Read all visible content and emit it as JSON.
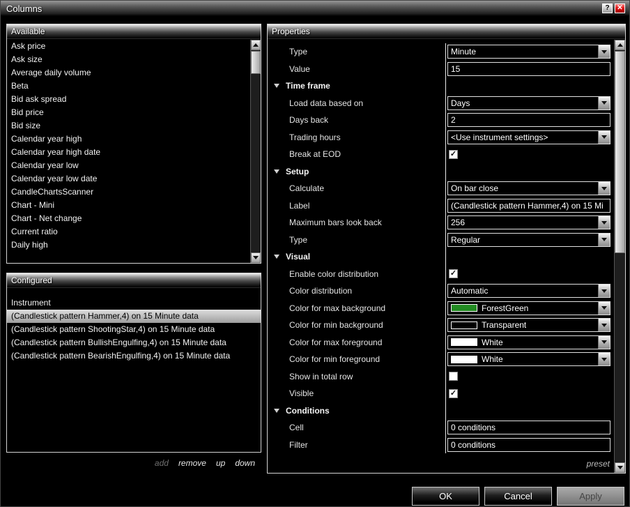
{
  "window": {
    "title": "Columns",
    "help_label": "?",
    "close_label": "✕"
  },
  "available_panel": {
    "header": "Available",
    "items": [
      "Ask price",
      "Ask size",
      "Average daily volume",
      "Beta",
      "Bid ask spread",
      "Bid price",
      "Bid size",
      "Calendar year high",
      "Calendar year high date",
      "Calendar year low",
      "Calendar year low date",
      "CandleChartsScanner",
      "Chart - Mini",
      "Chart - Net change",
      "Current ratio",
      "Daily high"
    ]
  },
  "configured_panel": {
    "header": "Configured",
    "items": [
      {
        "label": "Instrument",
        "selected": false
      },
      {
        "label": "(Candlestick pattern Hammer,4) on 15 Minute data",
        "selected": true
      },
      {
        "label": "(Candlestick pattern ShootingStar,4) on 15 Minute data",
        "selected": false
      },
      {
        "label": "(Candlestick pattern BullishEngulfing,4) on 15 Minute data",
        "selected": false
      },
      {
        "label": "(Candlestick pattern BearishEngulfing,4) on 15 Minute data",
        "selected": false
      }
    ],
    "actions": [
      {
        "label": "add",
        "enabled": false
      },
      {
        "label": "remove",
        "enabled": true
      },
      {
        "label": "up",
        "enabled": true
      },
      {
        "label": "down",
        "enabled": true
      }
    ]
  },
  "properties_panel": {
    "header": "Properties",
    "preset_label": "preset",
    "rows": [
      {
        "kind": "dropdown",
        "label": "Type",
        "value": "Minute"
      },
      {
        "kind": "input",
        "label": "Value",
        "value": "15"
      },
      {
        "kind": "section",
        "label": "Time frame"
      },
      {
        "kind": "dropdown",
        "label": "Load data based on",
        "value": "Days"
      },
      {
        "kind": "input",
        "label": "Days back",
        "value": "2"
      },
      {
        "kind": "dropdown",
        "label": "Trading hours",
        "value": "<Use instrument settings>"
      },
      {
        "kind": "checkbox",
        "label": "Break at EOD",
        "checked": true
      },
      {
        "kind": "section",
        "label": "Setup"
      },
      {
        "kind": "dropdown",
        "label": "Calculate",
        "value": "On bar close"
      },
      {
        "kind": "input",
        "label": "Label",
        "value": "(Candlestick pattern Hammer,4) on 15 Mi"
      },
      {
        "kind": "dropdown",
        "label": "Maximum bars look back",
        "value": "256"
      },
      {
        "kind": "dropdown",
        "label": "Type",
        "value": "Regular"
      },
      {
        "kind": "section",
        "label": "Visual"
      },
      {
        "kind": "checkbox",
        "label": "Enable color distribution",
        "checked": true
      },
      {
        "kind": "dropdown",
        "label": "Color distribution",
        "value": "Automatic"
      },
      {
        "kind": "color",
        "label": "Color for max background",
        "value": "ForestGreen",
        "swatch": "#228B22"
      },
      {
        "kind": "color",
        "label": "Color for min background",
        "value": "Transparent",
        "swatch": "transparent"
      },
      {
        "kind": "color",
        "label": "Color for max foreground",
        "value": "White",
        "swatch": "#FFFFFF"
      },
      {
        "kind": "color",
        "label": "Color for min foreground",
        "value": "White",
        "swatch": "#FFFFFF"
      },
      {
        "kind": "checkbox",
        "label": "Show in total row",
        "checked": false
      },
      {
        "kind": "checkbox",
        "label": "Visible",
        "checked": true
      },
      {
        "kind": "section",
        "label": "Conditions"
      },
      {
        "kind": "input",
        "label": "Cell",
        "value": "0 conditions"
      },
      {
        "kind": "input",
        "label": "Filter",
        "value": "0 conditions"
      }
    ]
  },
  "dialog_buttons": [
    {
      "label": "OK",
      "enabled": true
    },
    {
      "label": "Cancel",
      "enabled": true
    },
    {
      "label": "Apply",
      "enabled": false
    }
  ],
  "colors": {
    "close_button_red": "#C00000",
    "selection_background": "#B8B8B8",
    "forest_green": "#228B22",
    "white": "#FFFFFF"
  }
}
